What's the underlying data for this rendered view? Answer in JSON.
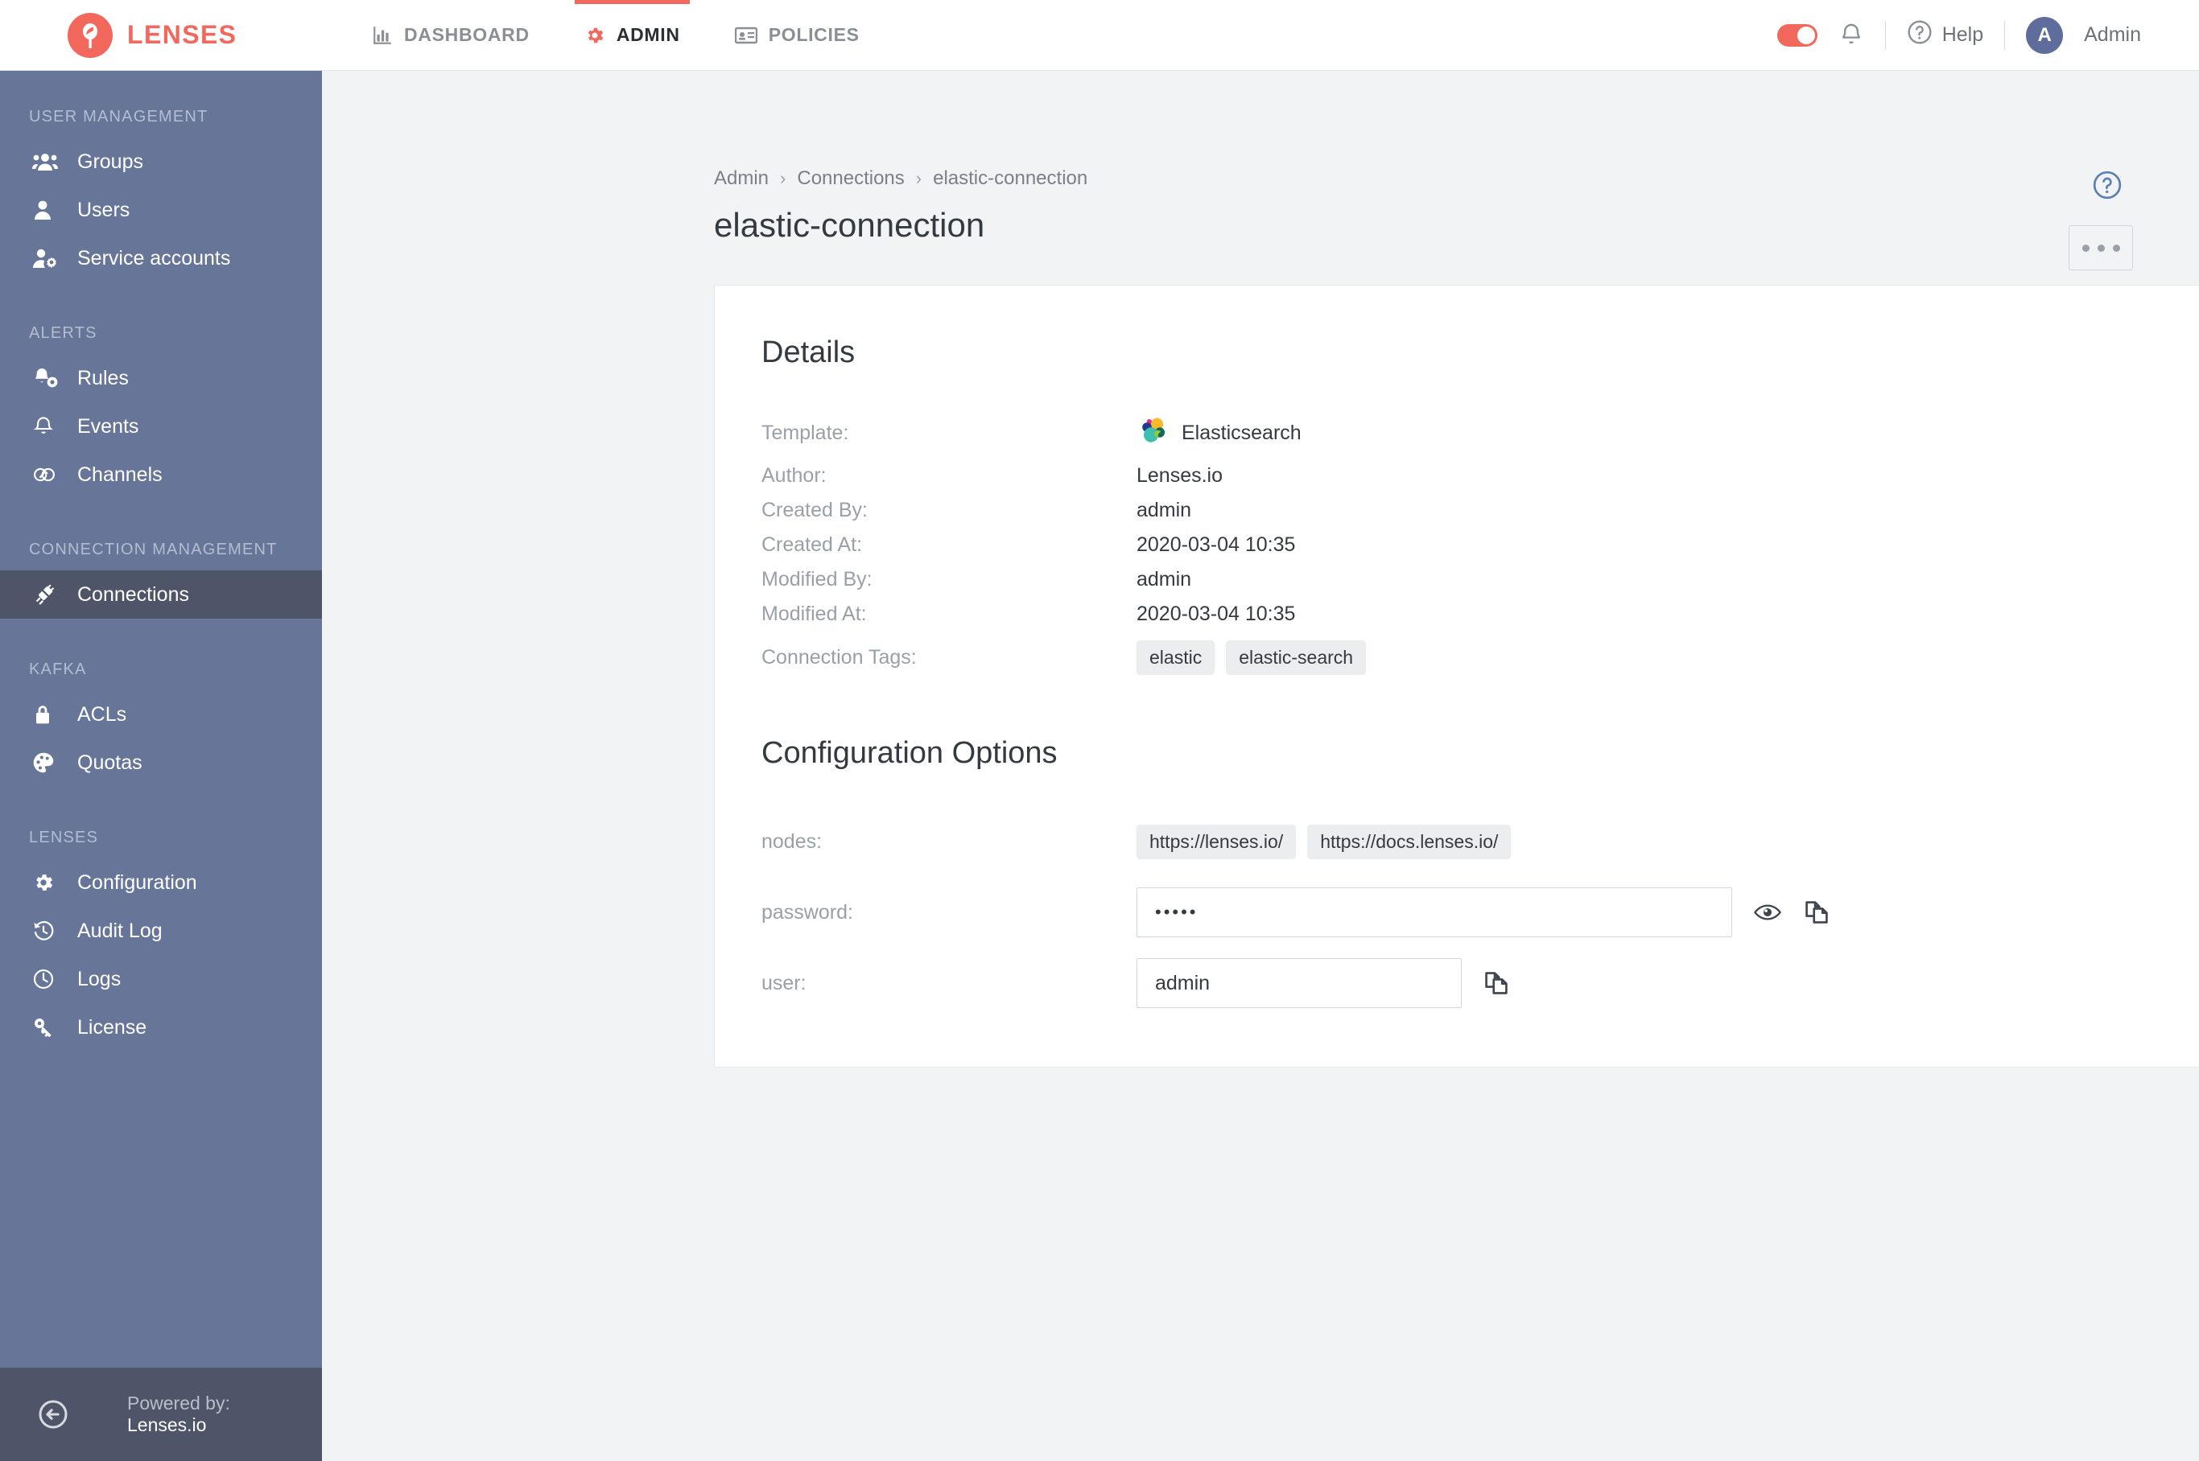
{
  "brand": {
    "name": "LENSES"
  },
  "topnav": {
    "items": [
      {
        "label": "DASHBOARD",
        "icon": "chart-bar-icon",
        "active": false
      },
      {
        "label": "ADMIN",
        "icon": "gear-icon",
        "active": true
      },
      {
        "label": "POLICIES",
        "icon": "id-card-icon",
        "active": false
      }
    ],
    "help_label": "Help",
    "user_initial": "A",
    "user_label": "Admin"
  },
  "sidebar": {
    "sections": [
      {
        "title": "USER MANAGEMENT",
        "items": [
          {
            "label": "Groups",
            "icon": "users-group-icon"
          },
          {
            "label": "Users",
            "icon": "user-icon"
          },
          {
            "label": "Service accounts",
            "icon": "user-gear-icon"
          }
        ]
      },
      {
        "title": "ALERTS",
        "items": [
          {
            "label": "Rules",
            "icon": "bell-gear-icon"
          },
          {
            "label": "Events",
            "icon": "bell-icon"
          },
          {
            "label": "Channels",
            "icon": "channels-icon"
          }
        ]
      },
      {
        "title": "CONNECTION MANAGEMENT",
        "items": [
          {
            "label": "Connections",
            "icon": "plug-icon",
            "active": true
          }
        ]
      },
      {
        "title": "KAFKA",
        "items": [
          {
            "label": "ACLs",
            "icon": "lock-icon"
          },
          {
            "label": "Quotas",
            "icon": "palette-icon"
          }
        ]
      },
      {
        "title": "LENSES",
        "items": [
          {
            "label": "Configuration",
            "icon": "gear-icon"
          },
          {
            "label": "Audit Log",
            "icon": "history-icon"
          },
          {
            "label": "Logs",
            "icon": "clock-icon"
          },
          {
            "label": "License",
            "icon": "key-icon"
          }
        ]
      }
    ],
    "footer": {
      "powered_prefix": "Powered by: ",
      "powered_name": "Lenses.io",
      "collapse_icon": "collapse-left-icon"
    }
  },
  "breadcrumb": {
    "items": [
      "Admin",
      "Connections",
      "elastic-connection"
    ],
    "separator": "›"
  },
  "page": {
    "title": "elastic-connection"
  },
  "details": {
    "heading": "Details",
    "rows": [
      {
        "label": "Template:",
        "value": "Elasticsearch",
        "icon": "elasticsearch-logo"
      },
      {
        "label": "Author:",
        "value": "Lenses.io"
      },
      {
        "label": "Created By:",
        "value": "admin"
      },
      {
        "label": "Created At:",
        "value": "2020-03-04 10:35"
      },
      {
        "label": "Modified By:",
        "value": "admin"
      },
      {
        "label": "Modified At:",
        "value": "2020-03-04 10:35"
      }
    ],
    "tags_label": "Connection Tags:",
    "tags": [
      "elastic",
      "elastic-search"
    ]
  },
  "configuration": {
    "heading": "Configuration Options",
    "nodes_label": "nodes:",
    "nodes": [
      "https://lenses.io/",
      "https://docs.lenses.io/"
    ],
    "password_label": "password:",
    "password_value": "•••••",
    "user_label": "user:",
    "user_value": "admin"
  },
  "colors": {
    "brand_red": "#f2685c",
    "sidebar_bg": "#677599",
    "sidebar_active": "#4e5568",
    "content_bg": "#f1f3f5",
    "avatar_bg": "#5f6d9c",
    "help_blue": "#5b7fb5"
  }
}
